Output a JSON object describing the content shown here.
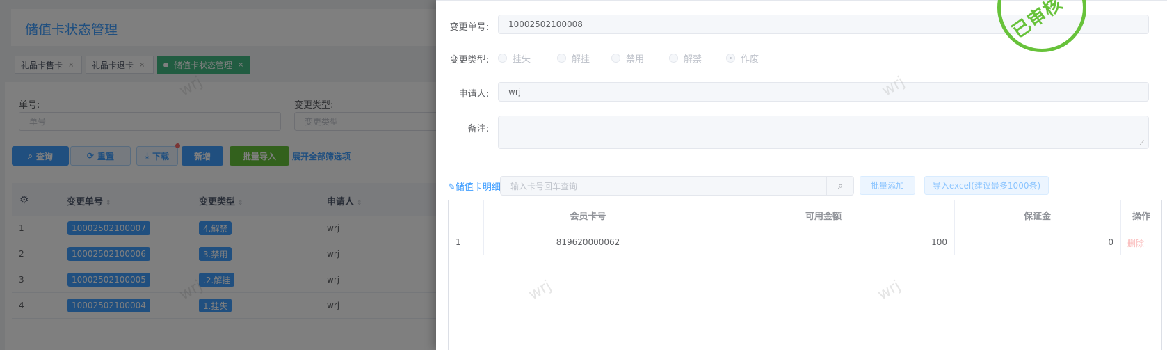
{
  "page": {
    "title": "储值卡状态管理",
    "tabs": [
      {
        "label": "礼品卡售卡",
        "close": "×"
      },
      {
        "label": "礼品卡退卡",
        "close": "×"
      },
      {
        "label": "储值卡状态管理",
        "close": "×"
      }
    ],
    "filters": {
      "no_label": "单号:",
      "no_placeholder": "单号",
      "type_label": "变更类型:",
      "type_placeholder": "变更类型"
    },
    "buttons": {
      "query": "查询",
      "reset": "重置",
      "download": "下载",
      "add": "新增",
      "import": "批量导入",
      "expand": "展开全部筛选项"
    },
    "table": {
      "headers": [
        "变更单号",
        "变更类型",
        "申请人"
      ],
      "rows": [
        {
          "index": "1",
          "no": "10002502100007",
          "type": "4.解禁",
          "applicant": "wrj"
        },
        {
          "index": "2",
          "no": "10002502100006",
          "type": "3.禁用",
          "applicant": "wrj"
        },
        {
          "index": "3",
          "no": "10002502100005",
          "type": ".2.解挂",
          "applicant": "wrj"
        },
        {
          "index": "4",
          "no": "10002502100004",
          "type": "1.挂失",
          "applicant": "wrj"
        }
      ]
    }
  },
  "drawer": {
    "no_label": "变更单号:",
    "no_value": "10002502100008",
    "type_label": "变更类型:",
    "types": [
      {
        "label": "挂失",
        "checked": false
      },
      {
        "label": "解挂",
        "checked": false
      },
      {
        "label": "禁用",
        "checked": false
      },
      {
        "label": "解禁",
        "checked": false
      },
      {
        "label": "作废",
        "checked": true
      }
    ],
    "applicant_label": "申请人:",
    "applicant_value": "wrj",
    "remark_label": "备注:",
    "remark_value": "",
    "stamp": "已审核",
    "detail": {
      "label": "储值卡明细",
      "search_placeholder": "输入卡号回车查询",
      "batch_add": "批量添加",
      "import_excel": "导入excel(建议最多1000条)",
      "headers": [
        "会员卡号",
        "可用金额",
        "保证金",
        "操作"
      ],
      "rows": [
        {
          "index": "1",
          "card": "819620000062",
          "amount": "100",
          "deposit": "0",
          "action": "删除"
        }
      ]
    }
  },
  "watermark": "wrj",
  "colors": {
    "primary": "#409eff",
    "success": "#67c23a",
    "tab_active": "#42b983",
    "danger": "#f56c6c"
  }
}
